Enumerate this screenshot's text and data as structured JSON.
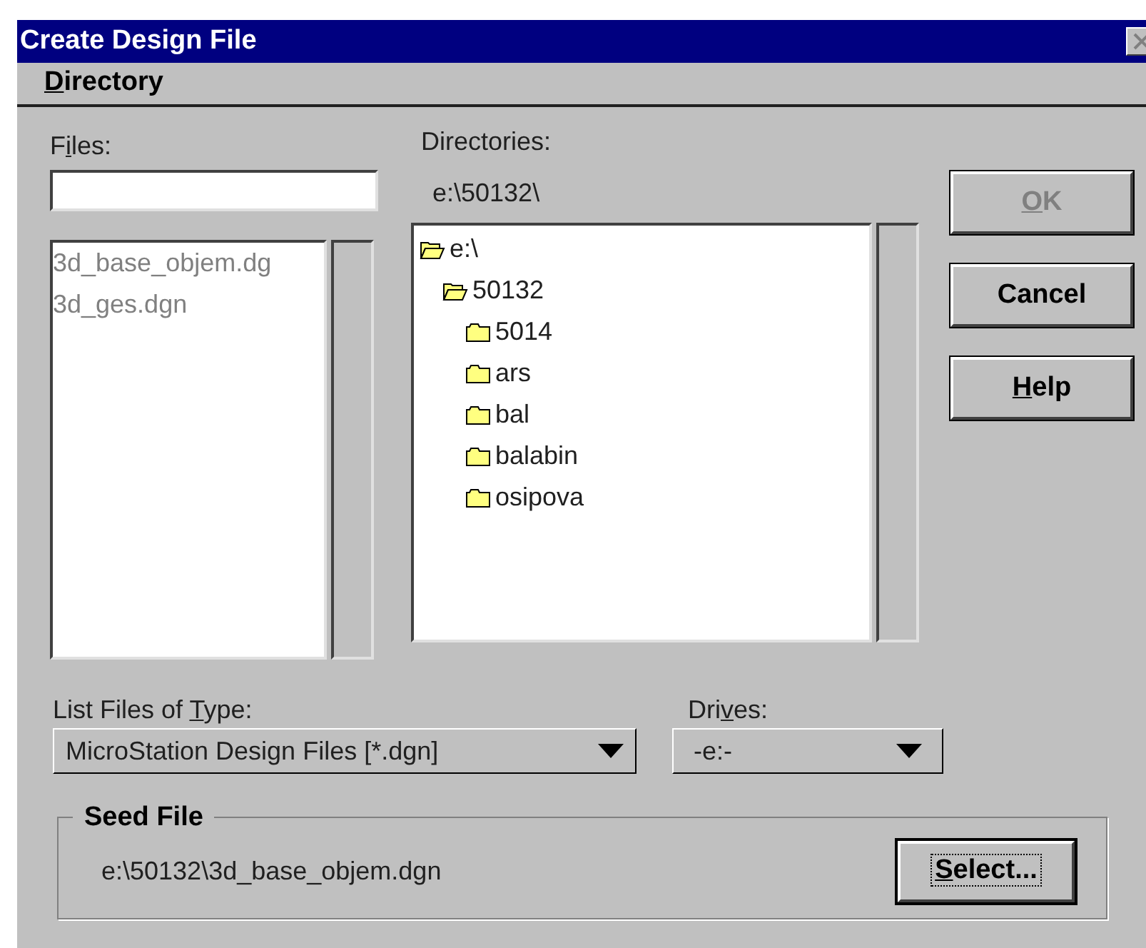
{
  "window": {
    "title": "Create Design File"
  },
  "menu": [
    {
      "label": [
        {
          "text": "D",
          "underlined": true
        },
        {
          "text": "irectory",
          "underlined": false
        }
      ]
    }
  ],
  "files": {
    "label": [
      {
        "text": "F",
        "underlined": false
      },
      {
        "text": "i",
        "underlined": true
      },
      {
        "text": "les:",
        "underlined": false
      }
    ],
    "items": [
      {
        "name": "3d_base_objem.dg",
        "disabled": true
      },
      {
        "name": "3d_ges.dgn",
        "disabled": true
      }
    ]
  },
  "directories": {
    "label": "Directories:",
    "path": "e:\\50132\\",
    "tree": [
      {
        "name": "e:\\",
        "expanded": true,
        "children": [
          {
            "name": "50132",
            "expanded": true,
            "children": [
              {
                "name": "5014",
                "expanded": false
              },
              {
                "name": "ars",
                "expanded": false
              },
              {
                "name": "bal",
                "expanded": false
              },
              {
                "name": "balabin",
                "expanded": false
              },
              {
                "name": "osipova",
                "expanded": false
              }
            ]
          }
        ]
      }
    ]
  },
  "buttons": [
    {
      "label": [
        {
          "text": "O",
          "underlined": true
        },
        {
          "text": "K",
          "underlined": false
        }
      ],
      "disabled": true
    },
    {
      "label": [
        {
          "text": "Cancel",
          "underlined": false
        }
      ],
      "disabled": false
    },
    {
      "label": [
        {
          "text": "H",
          "underlined": true
        },
        {
          "text": "elp",
          "underlined": false
        }
      ],
      "disabled": false
    }
  ],
  "file_type": {
    "label": [
      {
        "text": "List Files of ",
        "underlined": false
      },
      {
        "text": "T",
        "underlined": true
      },
      {
        "text": "ype:",
        "underlined": false
      }
    ],
    "value": "MicroStation Design Files [*.dgn]"
  },
  "drives": {
    "label": [
      {
        "text": "Dri",
        "underlined": false
      },
      {
        "text": "v",
        "underlined": true
      },
      {
        "text": "es:",
        "underlined": false
      }
    ],
    "value": "-e:-"
  },
  "seed_file": {
    "title": "Seed File",
    "path": "e:\\50132\\3d_base_objem.dgn",
    "button": {
      "label": [
        {
          "text": "S",
          "underlined": true
        },
        {
          "text": "elect...",
          "underlined": false
        }
      ],
      "focused": true
    }
  }
}
